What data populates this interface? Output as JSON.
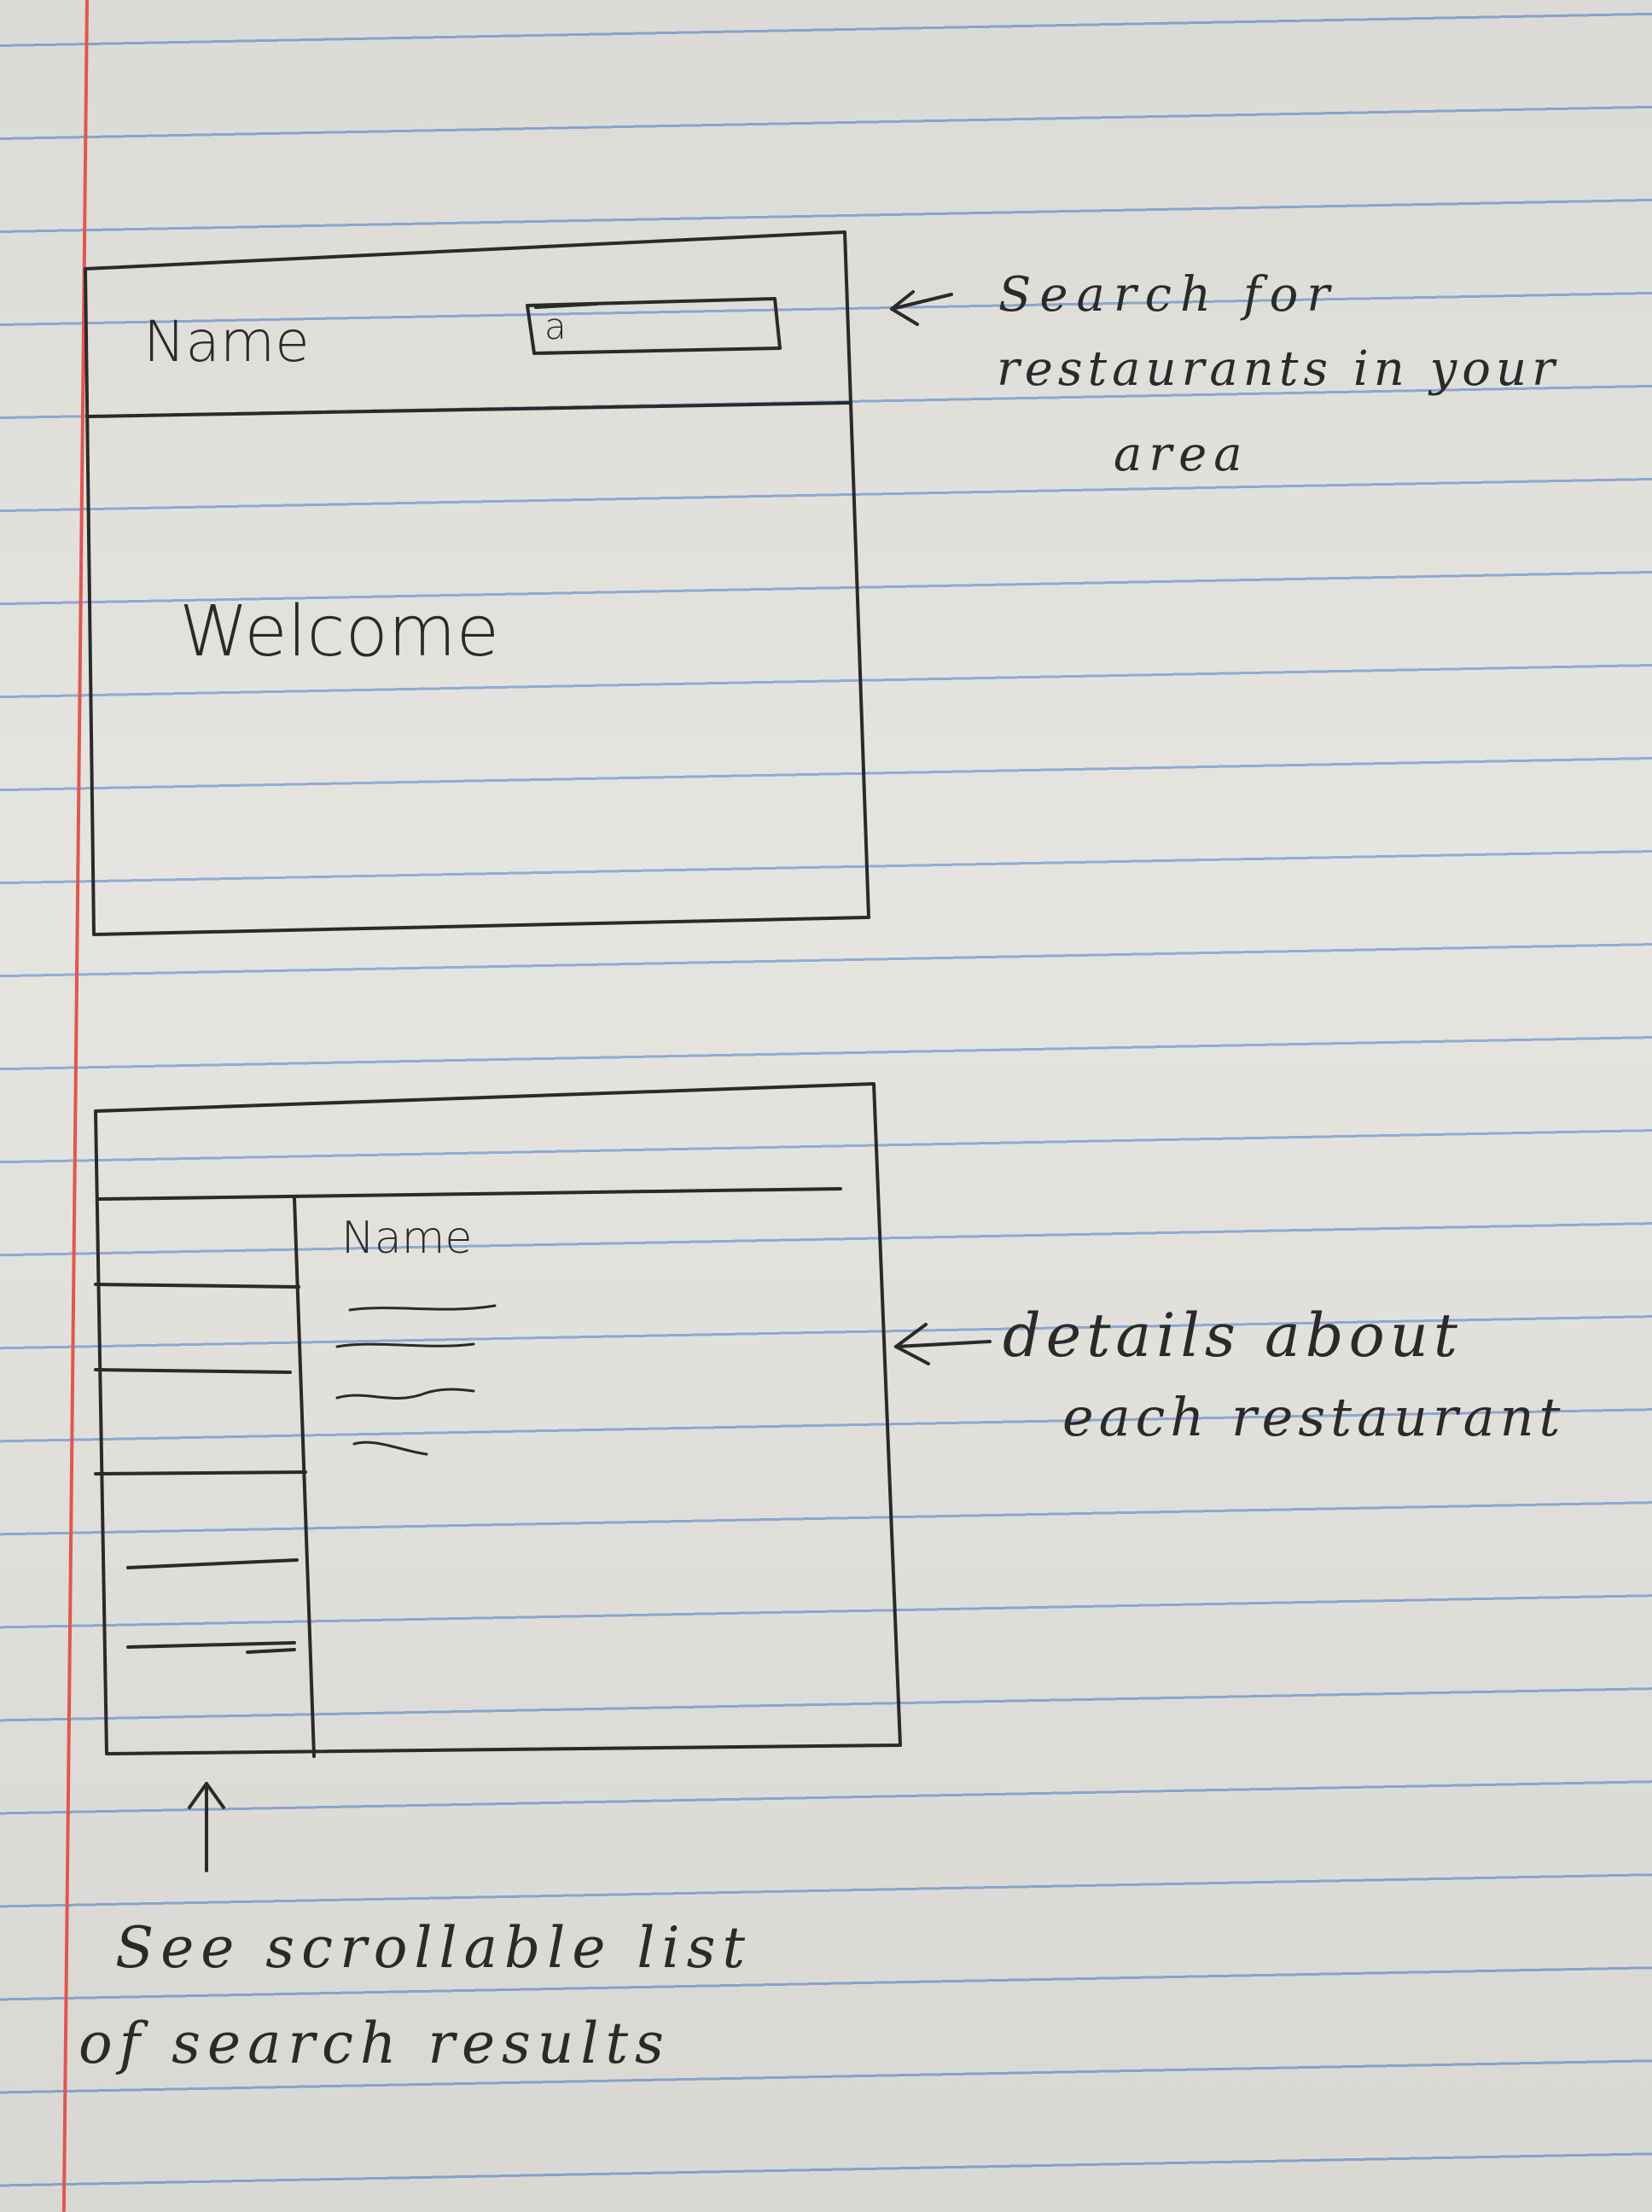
{
  "screen1": {
    "header_title": "Name",
    "search_placeholder": "a",
    "welcome_text": "Welcome"
  },
  "screen2": {
    "detail_title": "Name",
    "list_items_count_note": ""
  },
  "annotations": {
    "search_note_line1": "Search for",
    "search_note_line2": "restaurants in your",
    "search_note_line3": "area",
    "details_note_line1": "details about",
    "details_note_line2": "each restaurant",
    "list_note_line1": "See scrollable list",
    "list_note_line2": "of search results"
  },
  "colors": {
    "ink": "#2a2a2a",
    "rule_line": "#8fa7d4",
    "margin_line": "#e0574f",
    "paper": "#e4e3de"
  }
}
